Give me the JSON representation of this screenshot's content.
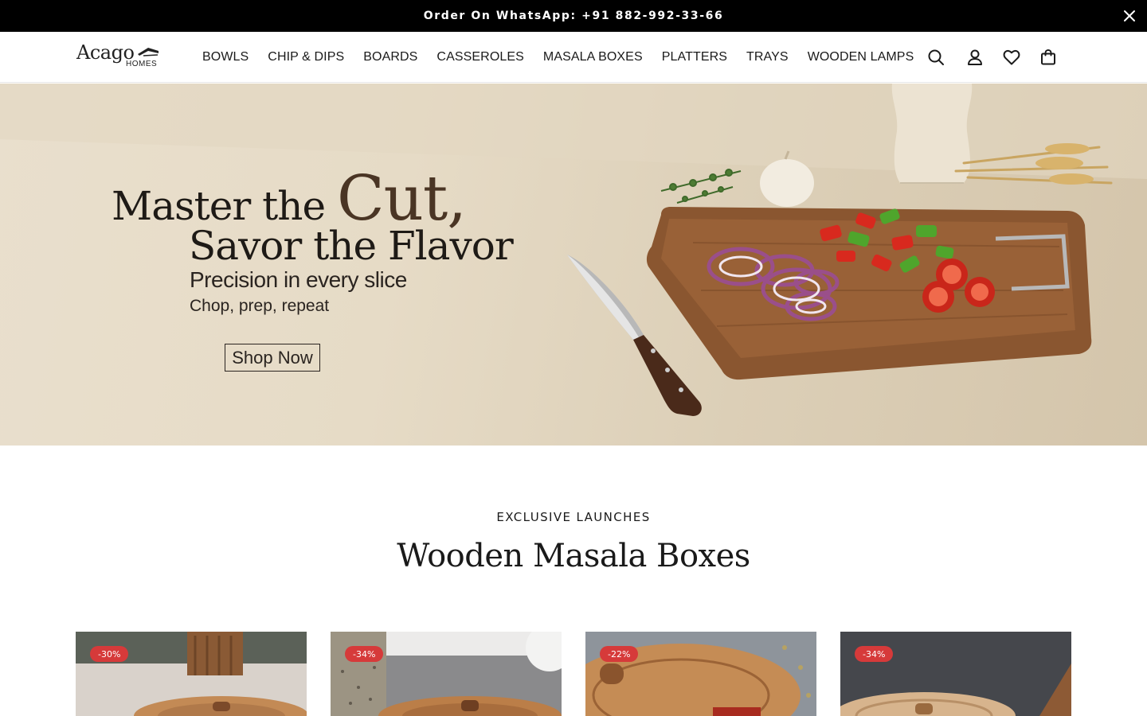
{
  "announcement": {
    "text": "Order On WhatsApp: +91 882-992-33-66",
    "close_icon": "close-icon"
  },
  "header": {
    "logo_main": "Acago",
    "logo_sub": "HOMES",
    "nav": [
      "BOWLS",
      "CHIP & DIPS",
      "BOARDS",
      "CASSEROLES",
      "MASALA BOXES",
      "PLATTERS",
      "TRAYS",
      "WOODEN LAMPS"
    ],
    "icons": [
      "search-icon",
      "account-icon",
      "wishlist-icon",
      "cart-icon"
    ]
  },
  "hero": {
    "line1_pre": "Master the",
    "line1_big": "Cut,",
    "line2": "Savor the Flavor",
    "line3": "Precision in every slice",
    "line4": "Chop, prep, repeat",
    "button": "Shop Now"
  },
  "section": {
    "eyebrow": "EXCLUSIVE LAUNCHES",
    "title": "Wooden Masala Boxes"
  },
  "products": [
    {
      "badge": "-30%"
    },
    {
      "badge": "-34%"
    },
    {
      "badge": "-22%"
    },
    {
      "badge": "-34%"
    }
  ],
  "colors": {
    "announcement_bg": "#000000",
    "badge_bg": "#d63a3a",
    "hero_bg": "#e6dbc6"
  }
}
